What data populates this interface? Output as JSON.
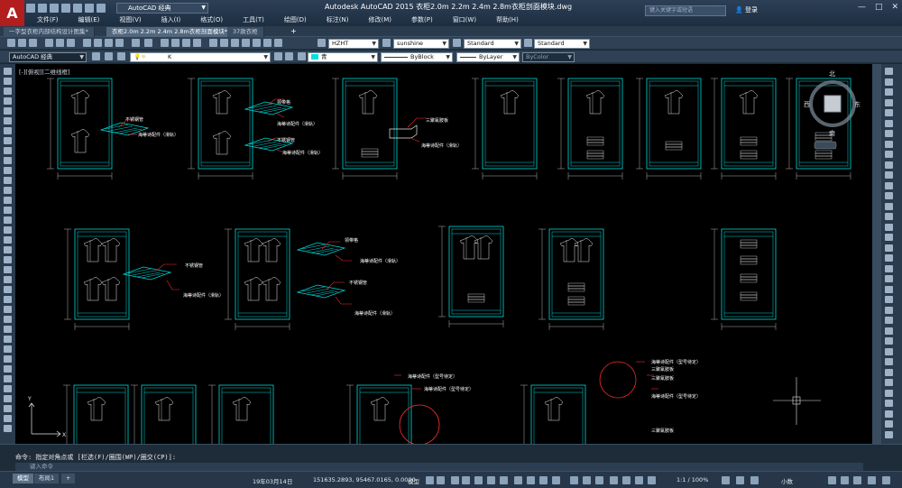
{
  "app": {
    "window_title": "Autodesk AutoCAD 2015    衣柜2.0m 2.2m 2.4m 2.8m衣柜剖面模块.dwg",
    "workspace": "AutoCAD 经典",
    "search_placeholder": "键入关键字或短语",
    "login": "登录",
    "window_buttons": [
      "—",
      "□",
      "✕"
    ]
  },
  "menu": [
    "文件(F)",
    "编辑(E)",
    "视图(V)",
    "插入(I)",
    "格式(O)",
    "工具(T)",
    "绘图(D)",
    "标注(N)",
    "修改(M)",
    "参数(P)",
    "窗口(W)",
    "帮助(H)"
  ],
  "tabs": [
    {
      "label": "一字型衣柜内部结构设计图集*",
      "active": false
    },
    {
      "label": "衣柜2.0m 2.2m 2.4m 2.8m衣柜剖面模块*",
      "active": true
    },
    {
      "label": "37款衣柜",
      "active": false
    }
  ],
  "toolbar": {
    "text_style": "HZHT",
    "dim_style": "sunshine",
    "table_style": "Standard",
    "mleader_style": "Standard",
    "workspace2": "AutoCAD 经典",
    "layer": "K",
    "color": "青",
    "linetype": "ByBlock",
    "lineweight": "ByLayer",
    "plotstyle": "ByColor"
  },
  "viewport_label": "[-][俯视][二维线框]",
  "viewcube": {
    "north": "北",
    "east": "东",
    "west": "西",
    "south": "南"
  },
  "annotations": {
    "stainless_tube": "不锈钢管",
    "hettich_rail": "海蒂诗配件（滑轨）",
    "shoe_rack": "领带格",
    "drawer": "三聚氰胺板",
    "hettich_fit": "海蒂诗配件（型号待定）"
  },
  "command": {
    "history": "命令:  指定对角点或 [栏选(F)/圈围(WP)/圈交(CP)]:",
    "placeholder": "键入命令"
  },
  "status": {
    "layouts": [
      {
        "label": "模型",
        "active": true
      },
      {
        "label": "布局1",
        "active": false
      }
    ],
    "date": "19年03月14日",
    "coords": "151635.2893, 95467.0165, 0.0000",
    "mode": "模型",
    "scale": "1:1 / 100%",
    "units": "小数"
  }
}
